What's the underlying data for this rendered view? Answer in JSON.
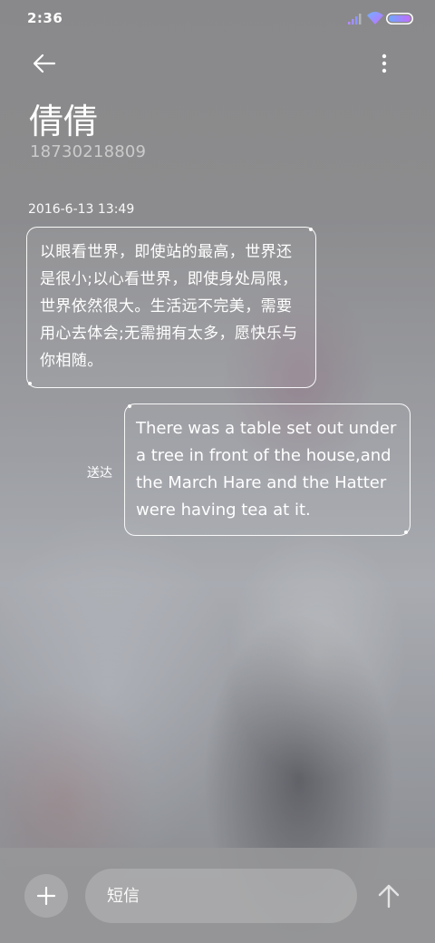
{
  "status_bar": {
    "time": "2:36",
    "icons": [
      "signal-icon",
      "wifi-icon",
      "battery-icon"
    ],
    "battery_gradient": [
      "#6ea8ff",
      "#c46cff"
    ]
  },
  "header": {
    "back_icon": "arrow-left-icon",
    "more_icon": "more-vertical-icon",
    "contact_name": "倩倩",
    "contact_number": "18730218809"
  },
  "messages": {
    "timestamp": "2016-6-13 13:49",
    "received": {
      "text": "以眼看世界，即使站的最高，世界还是很小;以心看世界，即使身处局限，世界依然很大。生活远不完美，需要用心去体会;无需拥有太多，愿快乐与你相随。"
    },
    "sent": {
      "text": "There was a table set out under a tree in front of the house,and the March Hare and the Hatter were having tea at it.",
      "status": "送达"
    }
  },
  "input_bar": {
    "add_icon": "plus-icon",
    "placeholder": "短信",
    "send_icon": "arrow-up-icon"
  }
}
